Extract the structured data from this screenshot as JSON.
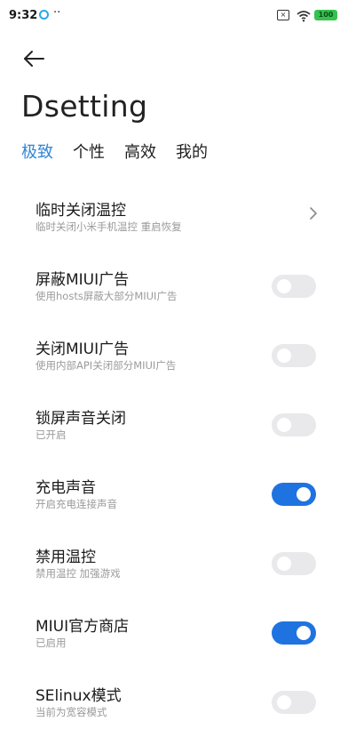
{
  "status_bar": {
    "time": "9:32",
    "dots": "··",
    "sim_label": "×",
    "battery": "100"
  },
  "header": {
    "title": "Dsetting"
  },
  "tabs": [
    {
      "label": "极致",
      "active": true
    },
    {
      "label": "个性",
      "active": false
    },
    {
      "label": "高效",
      "active": false
    },
    {
      "label": "我的",
      "active": false
    }
  ],
  "settings": [
    {
      "title": "临时关闭温控",
      "subtitle": "临时关闭小米手机温控 重启恢复",
      "control": "chevron"
    },
    {
      "title": "屏蔽MIUI广告",
      "subtitle": "使用hosts屏蔽大部分MIUI广告",
      "control": "toggle",
      "on": false
    },
    {
      "title": "关闭MIUI广告",
      "subtitle": "使用内部API关闭部分MIUI广告",
      "control": "toggle",
      "on": false
    },
    {
      "title": "锁屏声音关闭",
      "subtitle": "已开启",
      "control": "toggle",
      "on": false
    },
    {
      "title": "充电声音",
      "subtitle": "开启充电连接声音",
      "control": "toggle",
      "on": true
    },
    {
      "title": "禁用温控",
      "subtitle": "禁用温控 加强游戏",
      "control": "toggle",
      "on": false
    },
    {
      "title": "MIUI官方商店",
      "subtitle": "已启用",
      "control": "toggle",
      "on": true
    },
    {
      "title": "SElinux模式",
      "subtitle": "当前为宽容模式",
      "control": "toggle",
      "on": false
    }
  ],
  "colors": {
    "accent": "#2f86d6",
    "toggle_on": "#1f73e0",
    "toggle_off": "#e9e9ec",
    "battery": "#35c24f"
  }
}
